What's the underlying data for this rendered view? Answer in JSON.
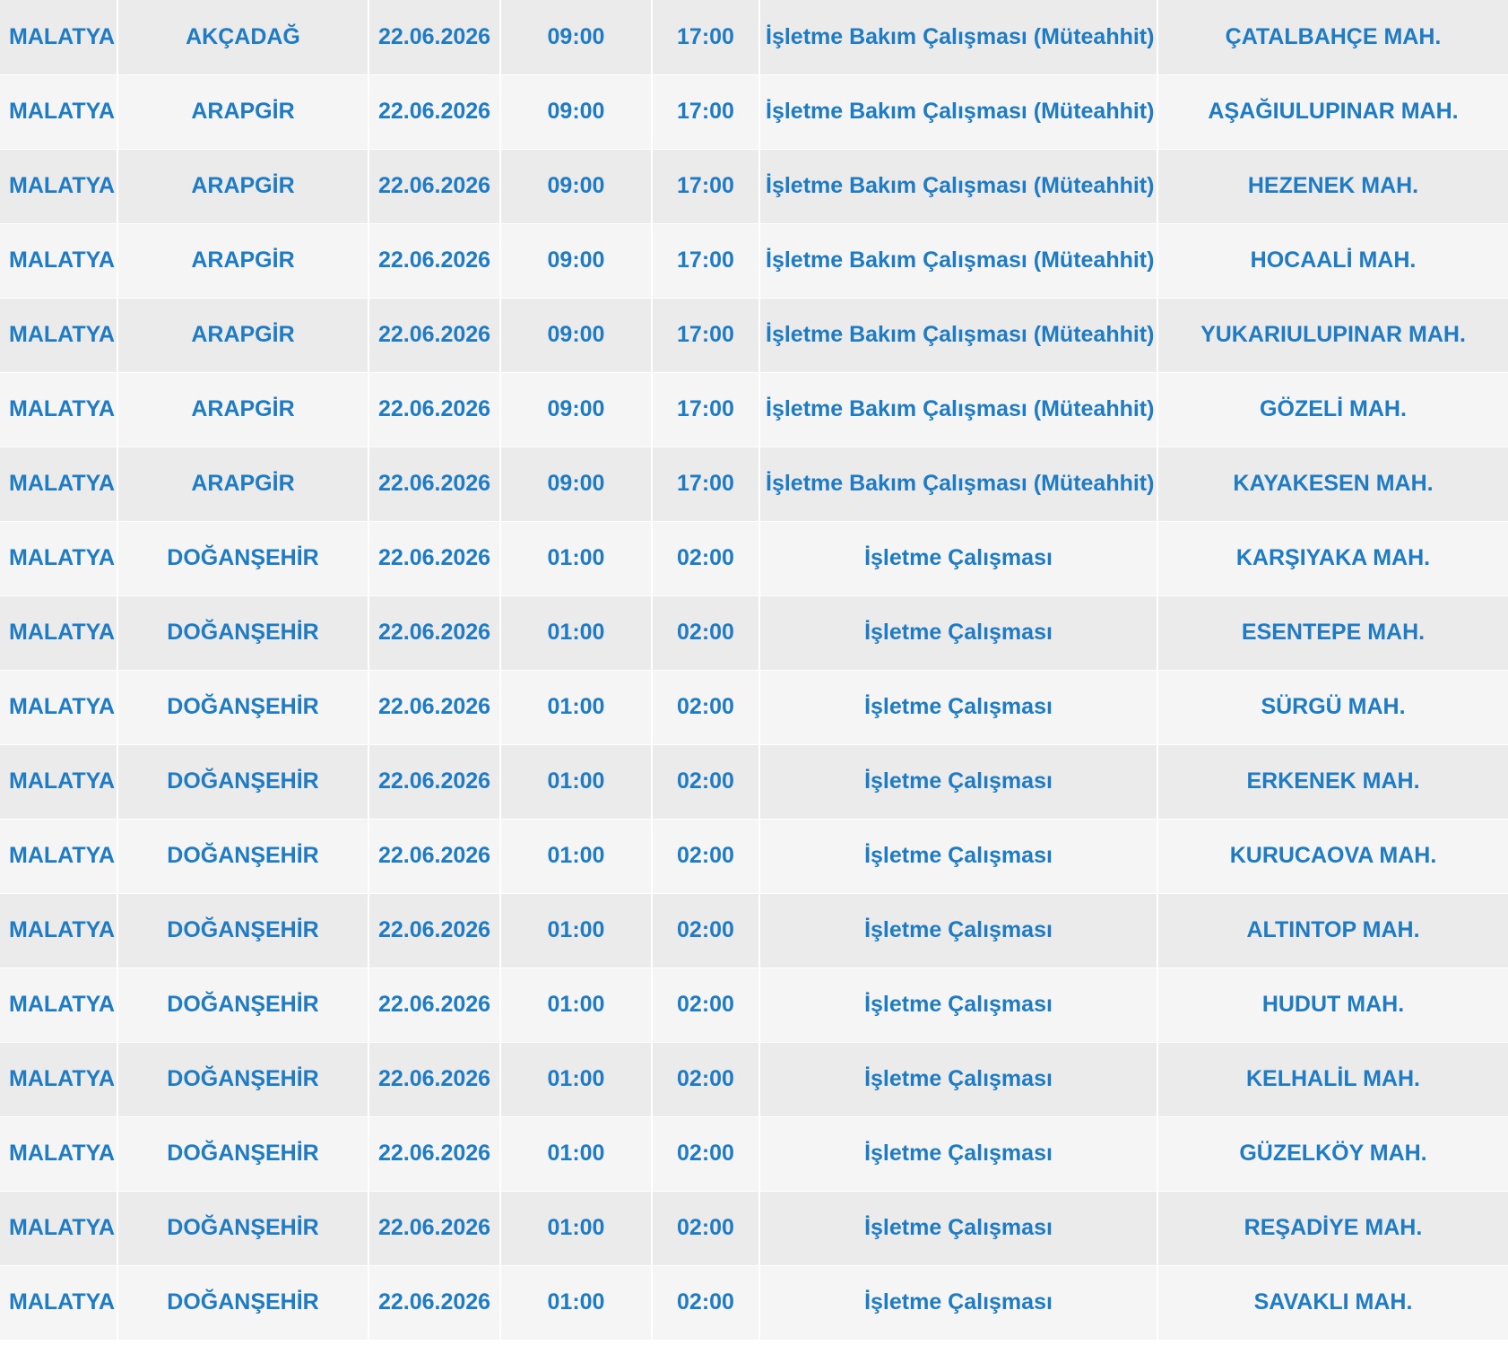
{
  "table": {
    "rows": [
      {
        "city": "MALATYA",
        "district": "AKÇADAĞ",
        "date": "22.06.2026",
        "start": "09:00",
        "end": "17:00",
        "reason": "İşletme Bakım Çalışması (Müteahhit)",
        "neighborhood": "ÇATALBAHÇE MAH."
      },
      {
        "city": "MALATYA",
        "district": "ARAPGİR",
        "date": "22.06.2026",
        "start": "09:00",
        "end": "17:00",
        "reason": "İşletme Bakım Çalışması (Müteahhit)",
        "neighborhood": "AŞAĞIULUPINAR MAH."
      },
      {
        "city": "MALATYA",
        "district": "ARAPGİR",
        "date": "22.06.2026",
        "start": "09:00",
        "end": "17:00",
        "reason": "İşletme Bakım Çalışması (Müteahhit)",
        "neighborhood": "HEZENEK MAH."
      },
      {
        "city": "MALATYA",
        "district": "ARAPGİR",
        "date": "22.06.2026",
        "start": "09:00",
        "end": "17:00",
        "reason": "İşletme Bakım Çalışması (Müteahhit)",
        "neighborhood": "HOCAALİ MAH."
      },
      {
        "city": "MALATYA",
        "district": "ARAPGİR",
        "date": "22.06.2026",
        "start": "09:00",
        "end": "17:00",
        "reason": "İşletme Bakım Çalışması (Müteahhit)",
        "neighborhood": "YUKARIULUPINAR MAH."
      },
      {
        "city": "MALATYA",
        "district": "ARAPGİR",
        "date": "22.06.2026",
        "start": "09:00",
        "end": "17:00",
        "reason": "İşletme Bakım Çalışması (Müteahhit)",
        "neighborhood": "GÖZELİ MAH."
      },
      {
        "city": "MALATYA",
        "district": "ARAPGİR",
        "date": "22.06.2026",
        "start": "09:00",
        "end": "17:00",
        "reason": "İşletme Bakım Çalışması (Müteahhit)",
        "neighborhood": "KAYAKESEN MAH."
      },
      {
        "city": "MALATYA",
        "district": "DOĞANŞEHİR",
        "date": "22.06.2026",
        "start": "01:00",
        "end": "02:00",
        "reason": "İşletme Çalışması",
        "neighborhood": "KARŞIYAKA MAH."
      },
      {
        "city": "MALATYA",
        "district": "DOĞANŞEHİR",
        "date": "22.06.2026",
        "start": "01:00",
        "end": "02:00",
        "reason": "İşletme Çalışması",
        "neighborhood": "ESENTEPE MAH."
      },
      {
        "city": "MALATYA",
        "district": "DOĞANŞEHİR",
        "date": "22.06.2026",
        "start": "01:00",
        "end": "02:00",
        "reason": "İşletme Çalışması",
        "neighborhood": "SÜRGÜ MAH."
      },
      {
        "city": "MALATYA",
        "district": "DOĞANŞEHİR",
        "date": "22.06.2026",
        "start": "01:00",
        "end": "02:00",
        "reason": "İşletme Çalışması",
        "neighborhood": "ERKENEK MAH."
      },
      {
        "city": "MALATYA",
        "district": "DOĞANŞEHİR",
        "date": "22.06.2026",
        "start": "01:00",
        "end": "02:00",
        "reason": "İşletme Çalışması",
        "neighborhood": "KURUCAOVA MAH."
      },
      {
        "city": "MALATYA",
        "district": "DOĞANŞEHİR",
        "date": "22.06.2026",
        "start": "01:00",
        "end": "02:00",
        "reason": "İşletme Çalışması",
        "neighborhood": "ALTINTOP MAH."
      },
      {
        "city": "MALATYA",
        "district": "DOĞANŞEHİR",
        "date": "22.06.2026",
        "start": "01:00",
        "end": "02:00",
        "reason": "İşletme Çalışması",
        "neighborhood": "HUDUT MAH."
      },
      {
        "city": "MALATYA",
        "district": "DOĞANŞEHİR",
        "date": "22.06.2026",
        "start": "01:00",
        "end": "02:00",
        "reason": "İşletme Çalışması",
        "neighborhood": "KELHALİL MAH."
      },
      {
        "city": "MALATYA",
        "district": "DOĞANŞEHİR",
        "date": "22.06.2026",
        "start": "01:00",
        "end": "02:00",
        "reason": "İşletme Çalışması",
        "neighborhood": "GÜZELKÖY MAH."
      },
      {
        "city": "MALATYA",
        "district": "DOĞANŞEHİR",
        "date": "22.06.2026",
        "start": "01:00",
        "end": "02:00",
        "reason": "İşletme Çalışması",
        "neighborhood": "REŞADİYE MAH."
      },
      {
        "city": "MALATYA",
        "district": "DOĞANŞEHİR",
        "date": "22.06.2026",
        "start": "01:00",
        "end": "02:00",
        "reason": "İşletme Çalışması",
        "neighborhood": "SAVAKLI MAH."
      }
    ]
  }
}
